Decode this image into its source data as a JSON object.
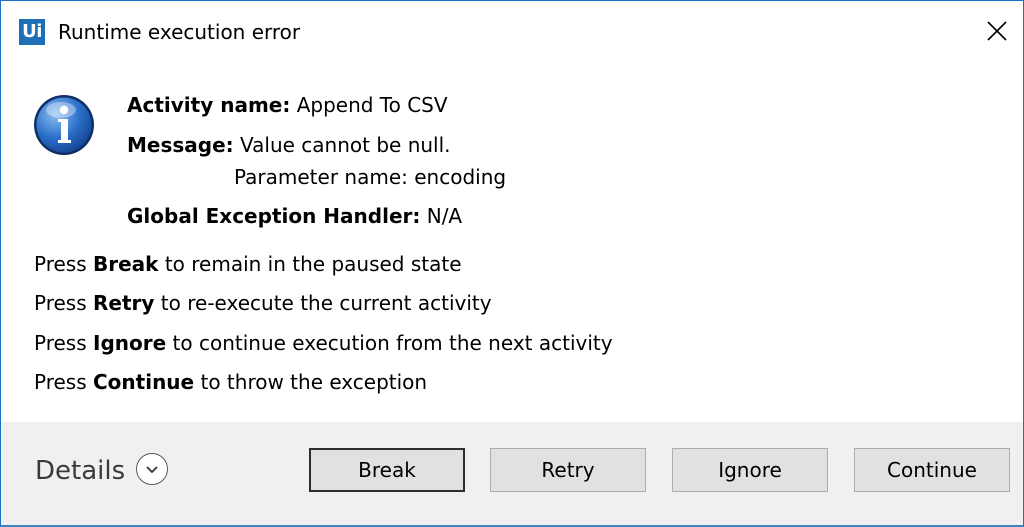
{
  "window": {
    "title": "Runtime execution error",
    "app_icon_text": "Ui",
    "accent_color": "#1d6fb8"
  },
  "error": {
    "activity_label": "Activity name:",
    "activity_value": "Append To CSV",
    "message_label": "Message:",
    "message_line1": "Value cannot be null.",
    "message_line2": "Parameter name: encoding",
    "handler_label": "Global Exception Handler:",
    "handler_value": "N/A"
  },
  "hints": [
    {
      "prefix": "Press",
      "keyword": "Break",
      "suffix": "to remain in the paused state"
    },
    {
      "prefix": "Press",
      "keyword": "Retry",
      "suffix": "to re-execute the current activity"
    },
    {
      "prefix": "Press",
      "keyword": "Ignore",
      "suffix": "to continue execution from the next activity"
    },
    {
      "prefix": "Press",
      "keyword": "Continue",
      "suffix": "to throw the exception"
    }
  ],
  "footer": {
    "details_label": "Details",
    "buttons": {
      "break": "Break",
      "retry": "Retry",
      "ignore": "Ignore",
      "continue": "Continue"
    }
  },
  "icons": {
    "app": "uipath-logo-icon",
    "close": "close-icon",
    "info": "info-icon",
    "details": "chevron-down-icon"
  }
}
